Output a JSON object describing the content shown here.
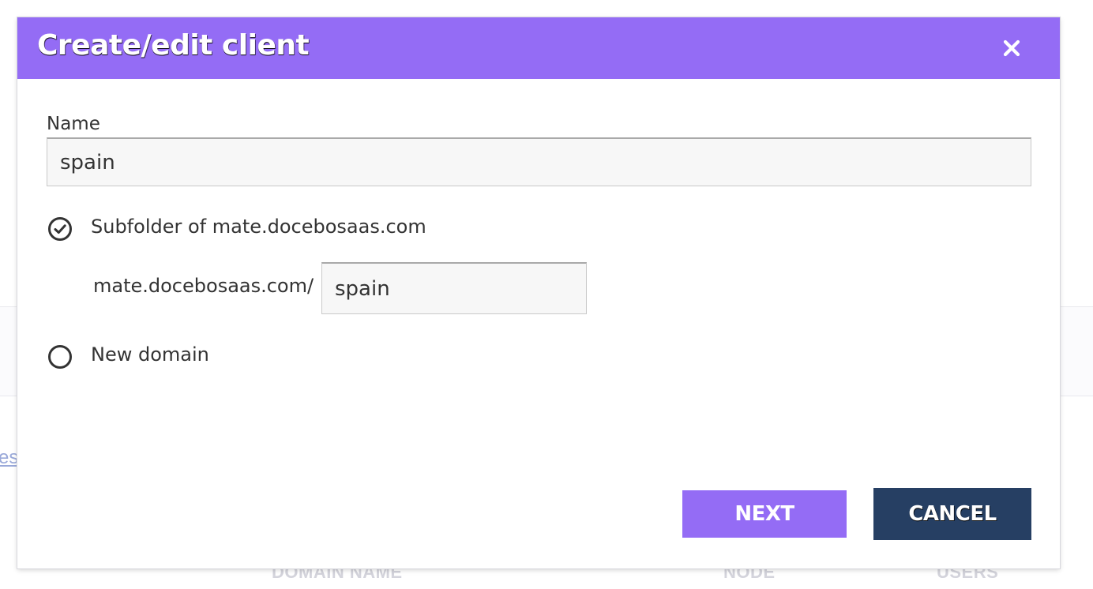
{
  "background": {
    "link_text": "es",
    "columns": [
      "DOMAIN NAME",
      "NODE",
      "USERS"
    ]
  },
  "modal": {
    "title": "Create/edit client",
    "close_icon": "close-icon",
    "header_color": "#946cf5",
    "name_label": "Name",
    "name_value": "spain",
    "options": {
      "subfolder_label": "Subfolder of mate.docebosaas.com",
      "subfolder_selected": true,
      "new_domain_label": "New domain",
      "new_domain_selected": false
    },
    "subfolder_prefix": "mate.docebosaas.com/",
    "subfolder_value": "spain",
    "buttons": {
      "next_label": "NEXT",
      "next_color": "#946cf5",
      "cancel_label": "CANCEL",
      "cancel_color": "#263f63"
    }
  }
}
